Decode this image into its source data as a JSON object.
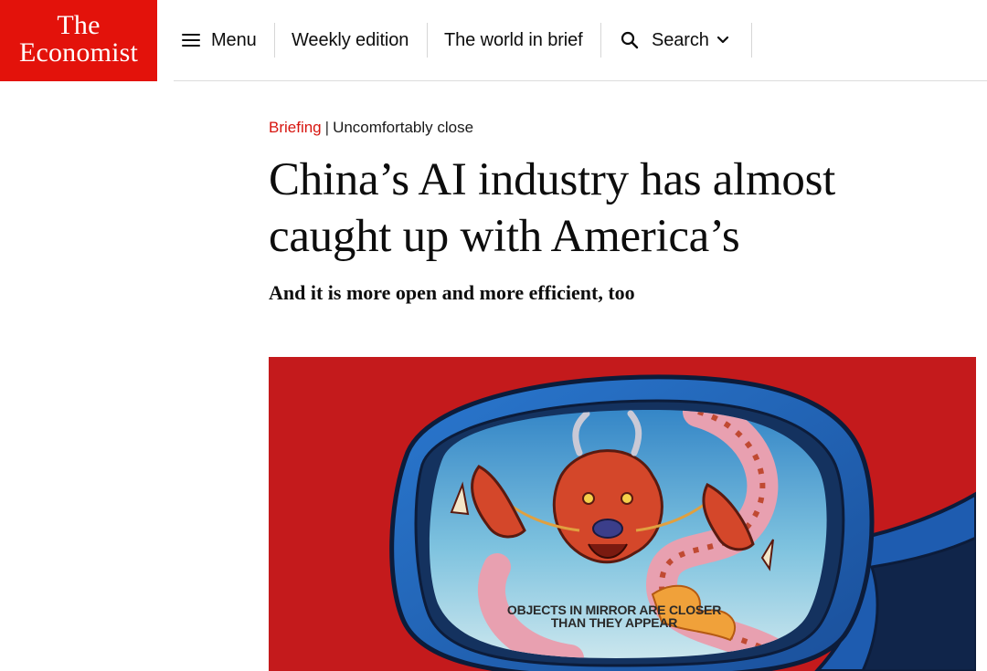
{
  "brand": {
    "logo_line1": "The",
    "logo_line2": "Economist",
    "brand_color": "#e3120b"
  },
  "nav": {
    "menu_label": "Menu",
    "weekly_edition_label": "Weekly edition",
    "world_in_brief_label": "The world in brief",
    "search_label": "Search",
    "icons": {
      "menu": "hamburger-icon",
      "search": "search-icon",
      "search_dropdown": "chevron-down-icon"
    }
  },
  "article": {
    "section": "Briefing",
    "separator": "|",
    "fly_title": "Uncomfortably close",
    "headline": "China’s AI industry has almost caught up with America’s",
    "subheadline": "And it is more open and more efficient, too",
    "section_color": "#d7150f"
  },
  "lead_image": {
    "mirror_text_line1": "OBJECTS IN MIRROR ARE CLOSER",
    "mirror_text_line2": "THAN THEY APPEAR",
    "background_color": "#c41a1c",
    "mirror_frame_color": "#1f5fb4"
  }
}
